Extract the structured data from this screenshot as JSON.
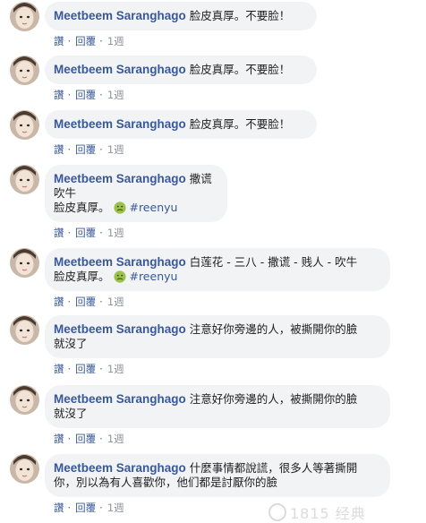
{
  "author": "Meetbeem Saranghago",
  "actions": {
    "like": "讚",
    "reply": "回覆",
    "sep": "·",
    "time": "1週"
  },
  "colors": {
    "author": "#385898",
    "bubble": "#f2f3f5",
    "meta": "#606770"
  },
  "comments": [
    {
      "lines": [
        "脸皮真厚。不要脸！"
      ]
    },
    {
      "lines": [
        "脸皮真厚。不要脸！"
      ]
    },
    {
      "lines": [
        "脸皮真厚。不要脸！"
      ]
    },
    {
      "lines": [
        "撒谎",
        "吹牛",
        "脸皮真厚。"
      ],
      "emoji": "nauseated-face-emoji",
      "hashtag": "#reenyu"
    },
    {
      "lines": [
        "白莲花 - 三八 - 撒谎 - 贱人 - 吹牛",
        "脸皮真厚。"
      ],
      "emoji": "nauseated-face-emoji",
      "hashtag": "#reenyu"
    },
    {
      "lines": [
        "注意好你旁邊的人，被撕開你的臉",
        "就沒了"
      ]
    },
    {
      "lines": [
        "注意好你旁邊的人，被撕開你的臉",
        "就沒了"
      ]
    },
    {
      "lines": [
        "什麼事情都說謊，很多人等著撕開",
        "你，別以為有人喜歡你，他们都是討厭你的臉"
      ]
    }
  ],
  "watermark": "1815 经典"
}
